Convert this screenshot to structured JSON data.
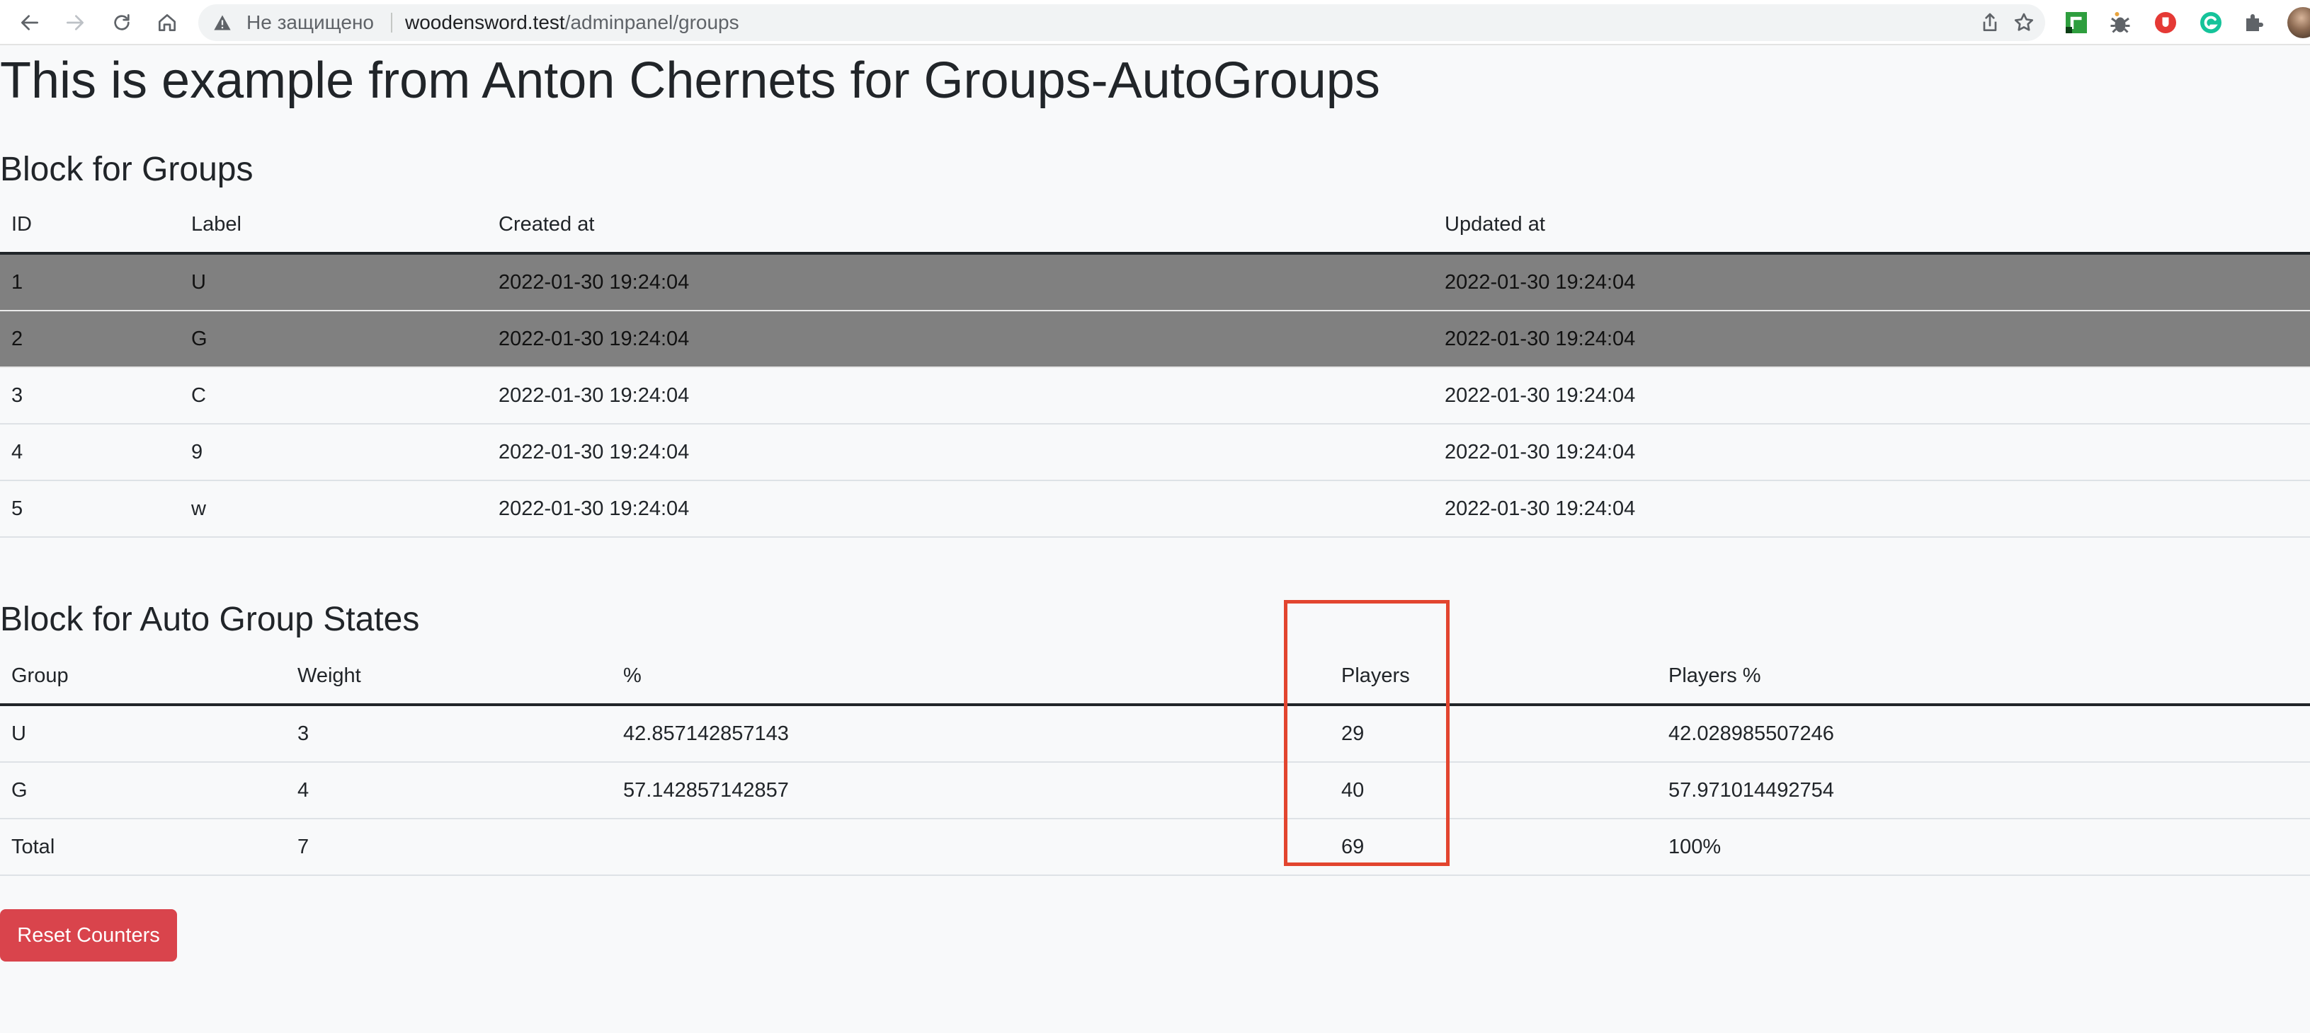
{
  "browser": {
    "security_label": "Не защищено",
    "url_host": "woodensword.test",
    "url_path": "/adminpanel/groups",
    "icons": [
      "back-icon",
      "forward-icon",
      "reload-icon",
      "home-icon",
      "warning-icon",
      "share-icon",
      "bookmark-star-icon",
      "extensions-puzzle-icon",
      "profile-avatar"
    ]
  },
  "page": {
    "title": "This is example from Anton Chernets for Groups-AutoGroups"
  },
  "groups_block": {
    "title": "Block for Groups",
    "headers": [
      "ID",
      "Label",
      "Created at",
      "Updated at"
    ],
    "rows": [
      [
        "1",
        "U",
        "2022-01-30 19:24:04",
        "2022-01-30 19:24:04"
      ],
      [
        "2",
        "G",
        "2022-01-30 19:24:04",
        "2022-01-30 19:24:04"
      ],
      [
        "3",
        "C",
        "2022-01-30 19:24:04",
        "2022-01-30 19:24:04"
      ],
      [
        "4",
        "9",
        "2022-01-30 19:24:04",
        "2022-01-30 19:24:04"
      ],
      [
        "5",
        "w",
        "2022-01-30 19:24:04",
        "2022-01-30 19:24:04"
      ]
    ]
  },
  "auto_block": {
    "title": "Block for Auto Group States",
    "headers": [
      "Group",
      "Weight",
      "%",
      "Players",
      "Players %"
    ],
    "rows": [
      [
        "U",
        "3",
        "42.857142857143",
        "29",
        "42.028985507246"
      ],
      [
        "G",
        "4",
        "57.142857142857",
        "40",
        "57.971014492754"
      ],
      [
        "Total",
        "7",
        "",
        "69",
        "100%"
      ]
    ]
  },
  "actions": {
    "reset_label": "Reset Counters",
    "reset_color": "#d9444c"
  },
  "colors": {
    "highlight_row": "#808080",
    "annotation_box": "#e2452f"
  }
}
